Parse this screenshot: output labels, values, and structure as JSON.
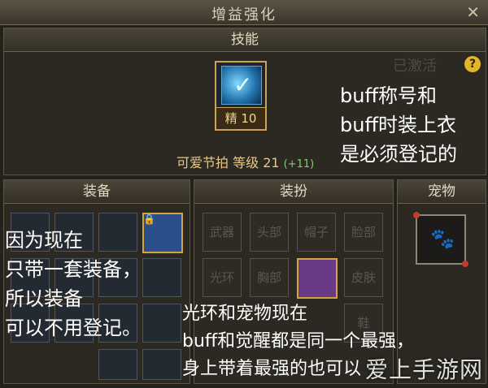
{
  "window": {
    "title": "增益强化",
    "close": "✕"
  },
  "skill": {
    "header": "技能",
    "grade_label": "精 10",
    "name": "可爱节拍",
    "level_label": "等级",
    "level": "21",
    "level_bonus": "(+11)",
    "help": "?",
    "faded_text": "已激活"
  },
  "equipment": {
    "header": "装备"
  },
  "outfit": {
    "header": "装扮",
    "slots": [
      "武器",
      "头部",
      "帽子",
      "脸部",
      "光环",
      "胸部",
      "皮肤",
      "鞋"
    ]
  },
  "pet": {
    "header": "宠物"
  },
  "annotations": {
    "a1_line1": "buff称号和",
    "a1_line2": "buff时装上衣",
    "a1_line3": "是必须登记的",
    "a2_line1": "因为现在",
    "a2_line2": "只带一套装备，",
    "a2_line3": "所以装备",
    "a2_line4": "可以不用登记。",
    "a3_line1": "光环和宠物现在",
    "a3_line2": "buff和觉醒都是同一个最强，",
    "a3_line3": "身上带着最强的也可以"
  },
  "watermark": "爱上手游网",
  "icons": {
    "skill": "sword-wing-icon",
    "pet": "paw-icon",
    "help": "question-icon",
    "close": "close-icon"
  }
}
